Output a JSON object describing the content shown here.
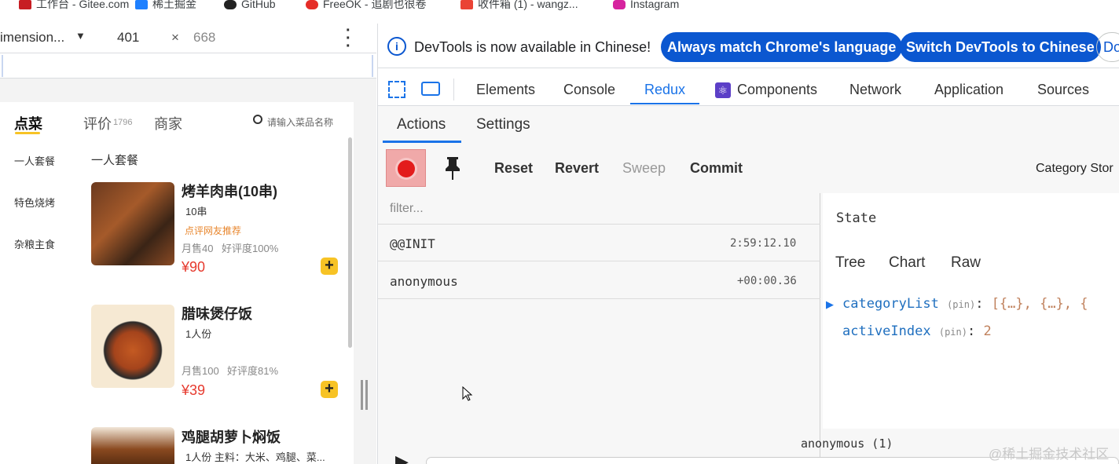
{
  "bookmarks": [
    "工作台 - Gitee.com",
    "稀土掘金",
    "GitHub",
    "FreeOK - 追剧也很卷",
    "收件箱 (1) - wangz...",
    "Instagram"
  ],
  "device_bar": {
    "dimension": "imension...",
    "width": "401",
    "times": "×",
    "height": "668"
  },
  "app": {
    "tabs": {
      "order": "点菜",
      "review": "评价",
      "review_count": "1796",
      "shop": "商家"
    },
    "search_placeholder": "请输入菜品名称",
    "sidebar": [
      "一人套餐",
      "特色烧烤",
      "杂粮主食"
    ],
    "section_title": "一人套餐",
    "dishes": [
      {
        "name": "烤羊肉串(10串)",
        "unit": "10串",
        "tag": "点评网友推荐",
        "sales": "月售40",
        "rating": "好评度100%",
        "price": "¥90"
      },
      {
        "name": "腊味煲仔饭",
        "unit": "1人份",
        "tag": "",
        "sales": "月售100",
        "rating": "好评度81%",
        "price": "¥39"
      },
      {
        "name": "鸡腿胡萝卜焖饭",
        "unit": "1人份 主料：大米、鸡腿、菜..."
      }
    ],
    "plus": "+"
  },
  "devtools": {
    "notice": "DevTools is now available in Chinese!",
    "btn_match": "Always match Chrome's language",
    "btn_switch": "Switch DevTools to Chinese",
    "btn_dont": "Do",
    "tabs": [
      "Elements",
      "Console",
      "Redux",
      "Components",
      "Network",
      "Application",
      "Sources"
    ],
    "redux": {
      "subtabs": [
        "Actions",
        "Settings"
      ],
      "buttons": [
        "Reset",
        "Revert",
        "Sweep",
        "Commit"
      ],
      "store": "Category Stor",
      "filter_placeholder": "filter...",
      "actions": [
        {
          "name": "@@INIT",
          "time": "2:59:12.10"
        },
        {
          "name": "anonymous",
          "time": "+00:00.36"
        }
      ],
      "state_title": "State",
      "views": [
        "Tree",
        "Chart",
        "Raw"
      ],
      "state": [
        {
          "key": "categoryList",
          "pin": "(pin)",
          "value": "[{…}, {…}, {"
        },
        {
          "key": "activeIndex",
          "pin": "(pin)",
          "value": "2"
        }
      ],
      "footer": "anonymous (1)"
    }
  },
  "watermark": "@稀土掘金技术社区",
  "colors": {
    "accent": "#0b57d0",
    "redux_tab": "#1a73e8",
    "price": "#e63a2e",
    "plus": "#f7c325",
    "record": "#e31c1c"
  }
}
